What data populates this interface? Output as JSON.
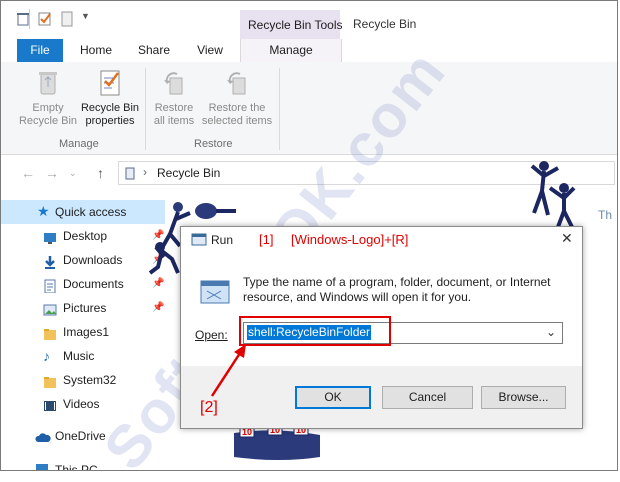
{
  "titlebar": {
    "tools_tab": "Recycle Bin Tools",
    "window_title": "Recycle Bin"
  },
  "ribbon_tabs": {
    "file": "File",
    "home": "Home",
    "share": "Share",
    "view": "View",
    "manage": "Manage"
  },
  "ribbon": {
    "empty_line1": "Empty",
    "empty_line2": "Recycle Bin",
    "props_line1": "Recycle Bin",
    "props_line2": "properties",
    "manage_group": "Manage",
    "restore_all_line1": "Restore",
    "restore_all_line2": "all items",
    "restore_sel_line1": "Restore the",
    "restore_sel_line2": "selected items",
    "restore_group": "Restore"
  },
  "address": {
    "location": "Recycle Bin"
  },
  "nav": {
    "items": [
      {
        "label": "Quick access"
      },
      {
        "label": "Desktop"
      },
      {
        "label": "Downloads"
      },
      {
        "label": "Documents"
      },
      {
        "label": "Pictures"
      },
      {
        "label": "Images1"
      },
      {
        "label": "Music"
      },
      {
        "label": "System32"
      },
      {
        "label": "Videos"
      },
      {
        "label": "OneDrive"
      },
      {
        "label": "This PC"
      }
    ]
  },
  "content_partial": "Th",
  "run": {
    "title": "Run",
    "description": "Type the name of a program, folder, document, or Internet resource, and Windows will open it for you.",
    "open_label": "Open:",
    "command": "shell:RecycleBinFolder",
    "ok": "OK",
    "cancel": "Cancel",
    "browse": "Browse..."
  },
  "annotations": {
    "step1_num": "[1]",
    "step1_text": "[Windows-Logo]+[R]",
    "step2": "[2]",
    "watermark": "SoftwareOK.com",
    "figure_badges": [
      "10",
      "10",
      "10"
    ]
  },
  "colors": {
    "accent": "#1979ca",
    "annotation_red": "#e00000",
    "tools_tab": "#e8e1f0"
  }
}
